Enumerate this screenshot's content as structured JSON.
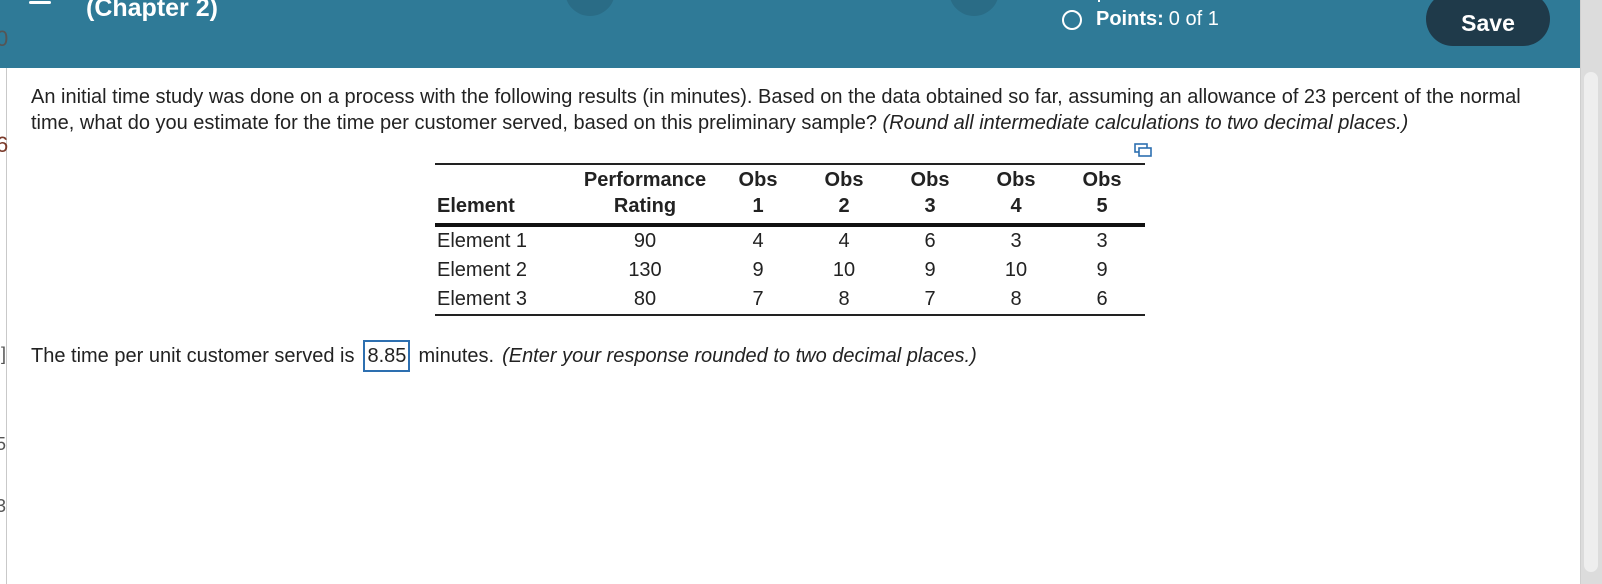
{
  "header": {
    "chapter_title": "(Chapter 2)",
    "points_label": "Points:",
    "points_value": "0 of 1",
    "save_label": "Save"
  },
  "question": {
    "text": "An initial time study was done on a process with the following results (in minutes). Based on the data obtained so far, assuming an allowance of 23 percent of the normal time, what do you estimate for the time per customer served, based on this preliminary sample?",
    "instruction": "(Round all intermediate calculations to two decimal places.)"
  },
  "table": {
    "headers": {
      "element": "Element",
      "rating_line1": "Performance",
      "rating_line2": "Rating",
      "obs_word": "Obs",
      "obs_numbers": [
        "1",
        "2",
        "3",
        "4",
        "5"
      ]
    },
    "rows": [
      {
        "element": "Element 1",
        "rating": "90",
        "obs": [
          "4",
          "4",
          "6",
          "3",
          "3"
        ]
      },
      {
        "element": "Element 2",
        "rating": "130",
        "obs": [
          "9",
          "10",
          "9",
          "10",
          "9"
        ]
      },
      {
        "element": "Element 3",
        "rating": "80",
        "obs": [
          "7",
          "8",
          "7",
          "8",
          "6"
        ]
      }
    ]
  },
  "answer": {
    "prefix": "The time per unit customer served is",
    "value": "8.85",
    "suffix": "minutes.",
    "instruction": "(Enter your response rounded to two decimal places.)"
  },
  "left_edge_glyphs": [
    "0",
    "6",
    ":]",
    "5",
    ":",
    "3"
  ],
  "colors": {
    "header_bg": "#2f7a97",
    "save_button_bg": "#1f3a4a",
    "input_border": "#2d6fb0"
  }
}
